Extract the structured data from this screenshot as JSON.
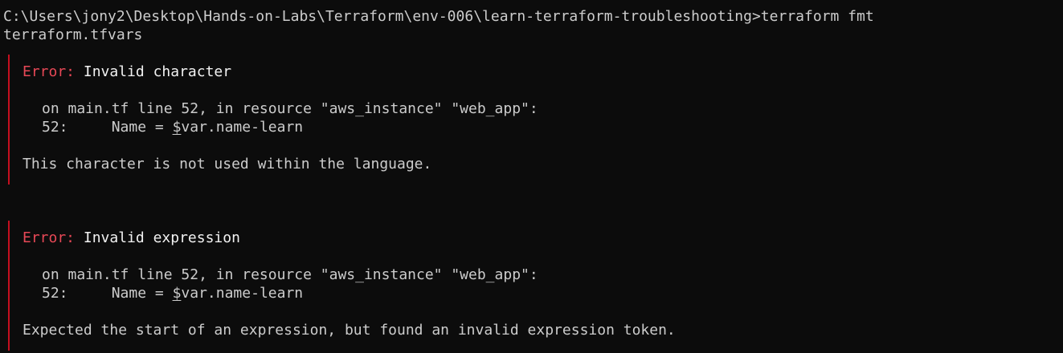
{
  "terminal": {
    "prompt_line": "C:\\Users\\jony2\\Desktop\\Hands-on-Labs\\Terraform\\env-006\\learn-terraform-troubleshooting>terraform fmt",
    "output_file": "terraform.tfvars",
    "errors": [
      {
        "label": "Error:",
        "summary": "Invalid character",
        "location": "on main.tf line 52, in resource \"aws_instance\" \"web_app\":",
        "code_line_prefix": "52:     Name = ",
        "code_line_dollar": "$",
        "code_line_suffix": "var.name-learn",
        "detail": "This character is not used within the language."
      },
      {
        "label": "Error:",
        "summary": "Invalid expression",
        "location": "on main.tf line 52, in resource \"aws_instance\" \"web_app\":",
        "code_line_prefix": "52:     Name = ",
        "code_line_dollar": "$",
        "code_line_suffix": "var.name-learn",
        "detail": "Expected the start of an expression, but found an invalid expression token."
      }
    ],
    "colors": {
      "background": "#0c0c0c",
      "text": "#cccccc",
      "error_label": "#e74856",
      "error_bar": "#c50f1f"
    }
  }
}
